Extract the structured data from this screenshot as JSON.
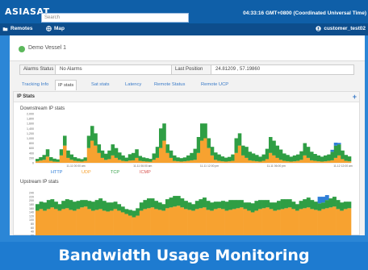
{
  "header": {
    "logo": "ASIASAT",
    "search_placeholder": "Search",
    "clock": "04:33:16 GMT+0800 (Coordinated Universal Time)"
  },
  "nav": {
    "remotes": "Remotes",
    "map": "Map",
    "user": "customer_test02"
  },
  "vessel": {
    "name": "Demo Vessel 1"
  },
  "status": {
    "alarms_label": "Alarms Status",
    "alarms_value": "No Alarms",
    "position_label": "Last Position",
    "position_value": "24.81209 , 57.19860"
  },
  "tabs": [
    "Tracking Info",
    "IP stats",
    "Sat stats",
    "Latency",
    "Remote Status",
    "Remote UCP"
  ],
  "section": {
    "title": "IP Stats",
    "plus": "+"
  },
  "colors": {
    "http": "#2f7ed8",
    "udp": "#f7a230",
    "tcp": "#2f9e44",
    "icmp": "#d9534f"
  },
  "chart_data": [
    {
      "type": "bar",
      "title": "Downstream IP stats",
      "legend": [
        "HTTP",
        "UDP",
        "TCP",
        "ICMP"
      ],
      "ylabel": "",
      "y_ticks": [
        "2,000",
        "1,800",
        "1,600",
        "1,400",
        "1,200",
        "1,000",
        "800",
        "600",
        "400",
        "200",
        "0"
      ],
      "x_ticks": [
        "11-11 00:00 am",
        "11-11 06:00 am",
        "11-11 12:00 pm",
        "11-11 06:00 pm",
        "11-12 12:00 am"
      ],
      "ylim": [
        0,
        2000
      ],
      "series": [
        {
          "name": "UDP",
          "values": [
            60,
            90,
            120,
            250,
            80,
            50,
            40,
            300,
            700,
            200,
            120,
            80,
            60,
            50,
            80,
            600,
            900,
            700,
            400,
            200,
            120,
            150,
            300,
            200,
            120,
            80,
            60,
            90,
            100,
            200,
            80,
            60,
            50,
            40,
            120,
            200,
            600,
            900,
            400,
            200,
            80,
            60,
            50,
            60,
            80,
            100,
            120,
            400,
            900,
            1000,
            600,
            300,
            120,
            80,
            60,
            50,
            60,
            80,
            400,
            700,
            300,
            200,
            100,
            80,
            60,
            50,
            80,
            150,
            400,
            300,
            200,
            120,
            80,
            60,
            50,
            60,
            80,
            120,
            300,
            200,
            100,
            80,
            60,
            50,
            60,
            80,
            100,
            200,
            300,
            150,
            80,
            60
          ]
        },
        {
          "name": "TCP",
          "values": [
            100,
            140,
            200,
            300,
            150,
            120,
            100,
            250,
            400,
            300,
            220,
            150,
            120,
            100,
            140,
            500,
            600,
            500,
            350,
            300,
            250,
            350,
            450,
            400,
            300,
            220,
            150,
            260,
            300,
            350,
            200,
            160,
            140,
            120,
            260,
            450,
            800,
            700,
            350,
            300,
            220,
            160,
            140,
            160,
            220,
            300,
            450,
            650,
            700,
            600,
            400,
            350,
            300,
            260,
            200,
            160,
            180,
            260,
            600,
            500,
            400,
            450,
            350,
            300,
            260,
            200,
            260,
            420,
            650,
            600,
            500,
            420,
            300,
            260,
            200,
            240,
            260,
            350,
            500,
            450,
            350,
            280,
            240,
            200,
            240,
            260,
            350,
            500,
            450,
            350,
            240,
            200
          ]
        },
        {
          "name": "HTTP",
          "values": [
            0,
            0,
            0,
            0,
            0,
            0,
            0,
            0,
            0,
            0,
            0,
            0,
            0,
            0,
            0,
            0,
            0,
            0,
            0,
            0,
            0,
            0,
            0,
            0,
            0,
            0,
            0,
            0,
            0,
            0,
            0,
            0,
            0,
            0,
            0,
            0,
            0,
            0,
            0,
            0,
            0,
            0,
            0,
            0,
            0,
            0,
            0,
            0,
            0,
            0,
            0,
            0,
            0,
            0,
            0,
            0,
            0,
            0,
            0,
            0,
            0,
            0,
            0,
            0,
            0,
            0,
            0,
            0,
            0,
            0,
            0,
            0,
            0,
            0,
            0,
            0,
            0,
            0,
            0,
            0,
            0,
            0,
            0,
            0,
            0,
            0,
            80,
            120,
            60,
            0,
            0,
            0
          ]
        }
      ]
    },
    {
      "type": "bar",
      "title": "Upstream IP stats",
      "y_ticks": [
        "240",
        "220",
        "200",
        "180",
        "160",
        "140",
        "120",
        "100",
        "80",
        "60",
        "40",
        "20"
      ],
      "ylim": [
        0,
        260
      ],
      "series": [
        {
          "name": "UDP",
          "values": [
            150,
            160,
            150,
            160,
            170,
            160,
            150,
            160,
            165,
            155,
            150,
            160,
            170,
            175,
            160,
            150,
            155,
            160,
            150,
            145,
            150,
            160,
            150,
            140,
            130,
            120,
            110,
            120,
            150,
            160,
            165,
            170,
            160,
            155,
            150,
            165,
            170,
            175,
            180,
            170,
            160,
            155,
            150,
            160,
            165,
            170,
            155,
            150,
            160,
            165,
            160,
            150,
            155,
            160,
            165,
            170,
            160,
            150,
            140,
            150,
            160,
            165,
            170,
            160,
            150,
            155,
            160,
            165,
            170,
            160,
            150,
            160,
            165,
            170,
            160,
            155,
            150,
            160,
            165,
            170,
            175,
            160,
            150,
            160,
            165
          ]
        },
        {
          "name": "TCP",
          "values": [
            40,
            45,
            50,
            55,
            50,
            45,
            40,
            50,
            55,
            60,
            55,
            50,
            45,
            40,
            50,
            55,
            60,
            65,
            60,
            55,
            50,
            45,
            40,
            35,
            30,
            35,
            40,
            45,
            50,
            55,
            60,
            55,
            50,
            45,
            40,
            55,
            60,
            65,
            60,
            55,
            50,
            45,
            40,
            50,
            55,
            60,
            55,
            50,
            45,
            40,
            50,
            55,
            60,
            55,
            50,
            45,
            40,
            50,
            55,
            60,
            55,
            50,
            45,
            40,
            50,
            55,
            60,
            55,
            50,
            45,
            40,
            50,
            55,
            60,
            55,
            50,
            45,
            40,
            50,
            55,
            60,
            55,
            50,
            45,
            40
          ]
        },
        {
          "name": "HTTP",
          "values": [
            0,
            0,
            0,
            0,
            0,
            0,
            0,
            0,
            0,
            0,
            0,
            0,
            0,
            0,
            0,
            0,
            0,
            0,
            0,
            0,
            0,
            0,
            0,
            0,
            0,
            0,
            0,
            0,
            0,
            0,
            0,
            0,
            0,
            0,
            0,
            0,
            0,
            0,
            0,
            0,
            0,
            0,
            0,
            0,
            0,
            0,
            0,
            0,
            0,
            0,
            0,
            0,
            0,
            0,
            0,
            0,
            0,
            0,
            0,
            0,
            0,
            0,
            0,
            0,
            0,
            0,
            0,
            0,
            0,
            0,
            0,
            0,
            0,
            0,
            0,
            0,
            40,
            35,
            30,
            0,
            0,
            0,
            0,
            0,
            0
          ]
        }
      ]
    }
  ],
  "banner": "Bandwidth Usage Monitoring"
}
